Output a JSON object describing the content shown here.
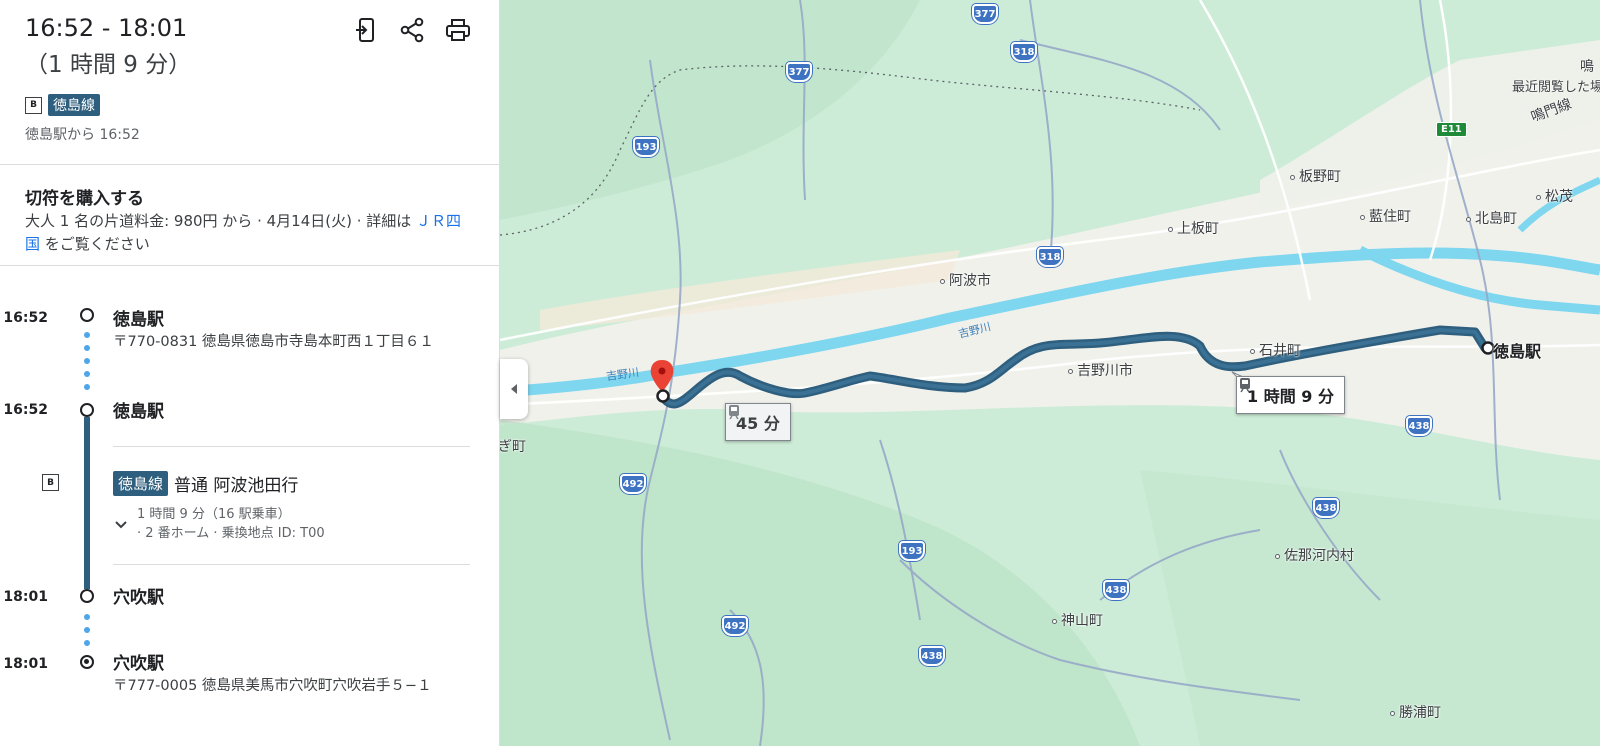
{
  "header": {
    "time_range": "16:52 - 18:01",
    "duration": "（1 時間 9 分）",
    "line_badge": "B",
    "line_name": "徳島線",
    "departure_note": "徳島駅から 16:52",
    "icons": [
      "send-to-phone-icon",
      "share-icon",
      "print-icon"
    ]
  },
  "ticket": {
    "title": "切符を購入する",
    "text_before_link": "大人 1 名の片道料金: 980円 から · 4月14日(火) · 詳細は ",
    "link": "ＪＲ四国",
    "text_after_link": " をご覧ください"
  },
  "itinerary": {
    "stops": [
      {
        "time": "16:52",
        "name": "徳島駅",
        "address": "〒770-0831 徳島県徳島市寺島本町西１丁目６１"
      },
      {
        "time": "16:52",
        "name": "徳島駅"
      },
      {
        "time": "18:01",
        "name": "穴吹駅"
      },
      {
        "time": "18:01",
        "name": "穴吹駅",
        "address": "〒777-0005 徳島県美馬市穴吹町穴吹岩手５−１"
      }
    ],
    "segment": {
      "badge": "B",
      "line": "徳島線",
      "service": "普通 阿波池田行",
      "detail_line1": "1 時間 9 分（16 駅乗車）",
      "detail_line2": "· 2 番ホーム · 乗換地点 ID: T00"
    }
  },
  "map": {
    "places": [
      {
        "name": "徳島駅",
        "kind": "station"
      },
      {
        "name": "吉野川市"
      },
      {
        "name": "阿波市"
      },
      {
        "name": "石井町"
      },
      {
        "name": "上板町"
      },
      {
        "name": "板野町"
      },
      {
        "name": "藍住町"
      },
      {
        "name": "北島町"
      },
      {
        "name": "松茂"
      },
      {
        "name": "鳴門線"
      },
      {
        "name": "最近閲覧した場"
      },
      {
        "name": "佐那河内村"
      },
      {
        "name": "神山町"
      },
      {
        "name": "勝浦町"
      },
      {
        "name": "ぎ町"
      },
      {
        "name": "鳴"
      }
    ],
    "rivers": [
      "吉野川",
      "吉野川"
    ],
    "route_shields": [
      "377",
      "318",
      "377",
      "193",
      "318",
      "492",
      "193",
      "492",
      "438",
      "438",
      "438",
      "438"
    ],
    "expressway": "E11",
    "callouts": {
      "selected": "1 時間 9 分",
      "alternative": "45 分"
    },
    "colors": {
      "route": "#2f5f7e",
      "water": "#7fd6ef",
      "land": "#cdecd7",
      "urban": "#f1f1ec"
    }
  }
}
